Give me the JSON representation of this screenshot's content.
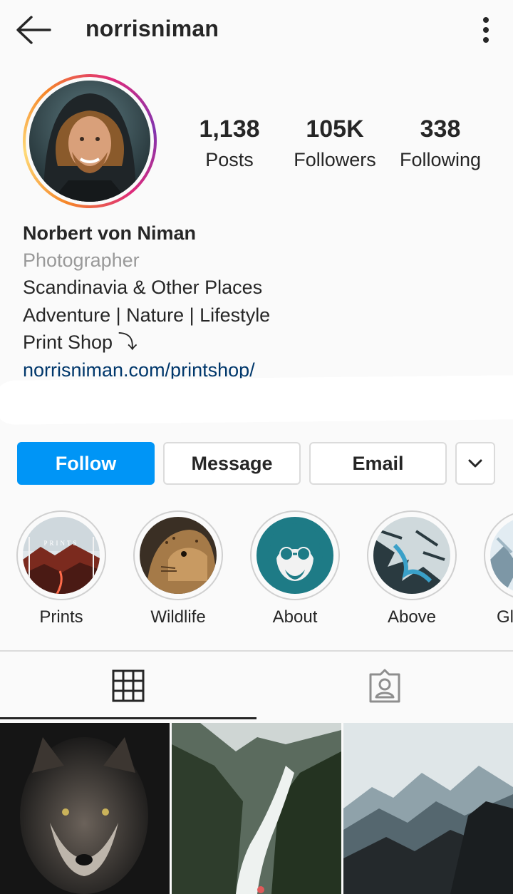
{
  "header": {
    "username": "norrisniman",
    "back_icon": "arrow-left-icon",
    "more_icon": "three-dots-vertical-icon"
  },
  "stats": [
    {
      "value": "1,138",
      "label": "Posts"
    },
    {
      "value": "105K",
      "label": "Followers"
    },
    {
      "value": "338",
      "label": "Following"
    }
  ],
  "bio": {
    "name": "Norbert von Niman",
    "category": "Photographer",
    "lines": [
      "Scandinavia & Other Places",
      "Adventure | Nature | Lifestyle",
      "Print Shop ⤵"
    ],
    "link": "norrisniman.com/printshop/"
  },
  "actions": {
    "follow": "Follow",
    "message": "Message",
    "email": "Email",
    "more_icon": "chevron-down-icon"
  },
  "highlights": [
    {
      "label": "Prints",
      "overlay": "PRINTS"
    },
    {
      "label": "Wildlife"
    },
    {
      "label": "About"
    },
    {
      "label": "Above"
    },
    {
      "label": "Gl"
    }
  ],
  "tabs": [
    {
      "icon": "grid-icon",
      "active": true
    },
    {
      "icon": "tagged-person-icon",
      "active": false
    }
  ],
  "colors": {
    "accent": "#0095f6",
    "link": "#00376b",
    "text": "#262626",
    "muted": "#999999",
    "background": "#fafafa"
  }
}
